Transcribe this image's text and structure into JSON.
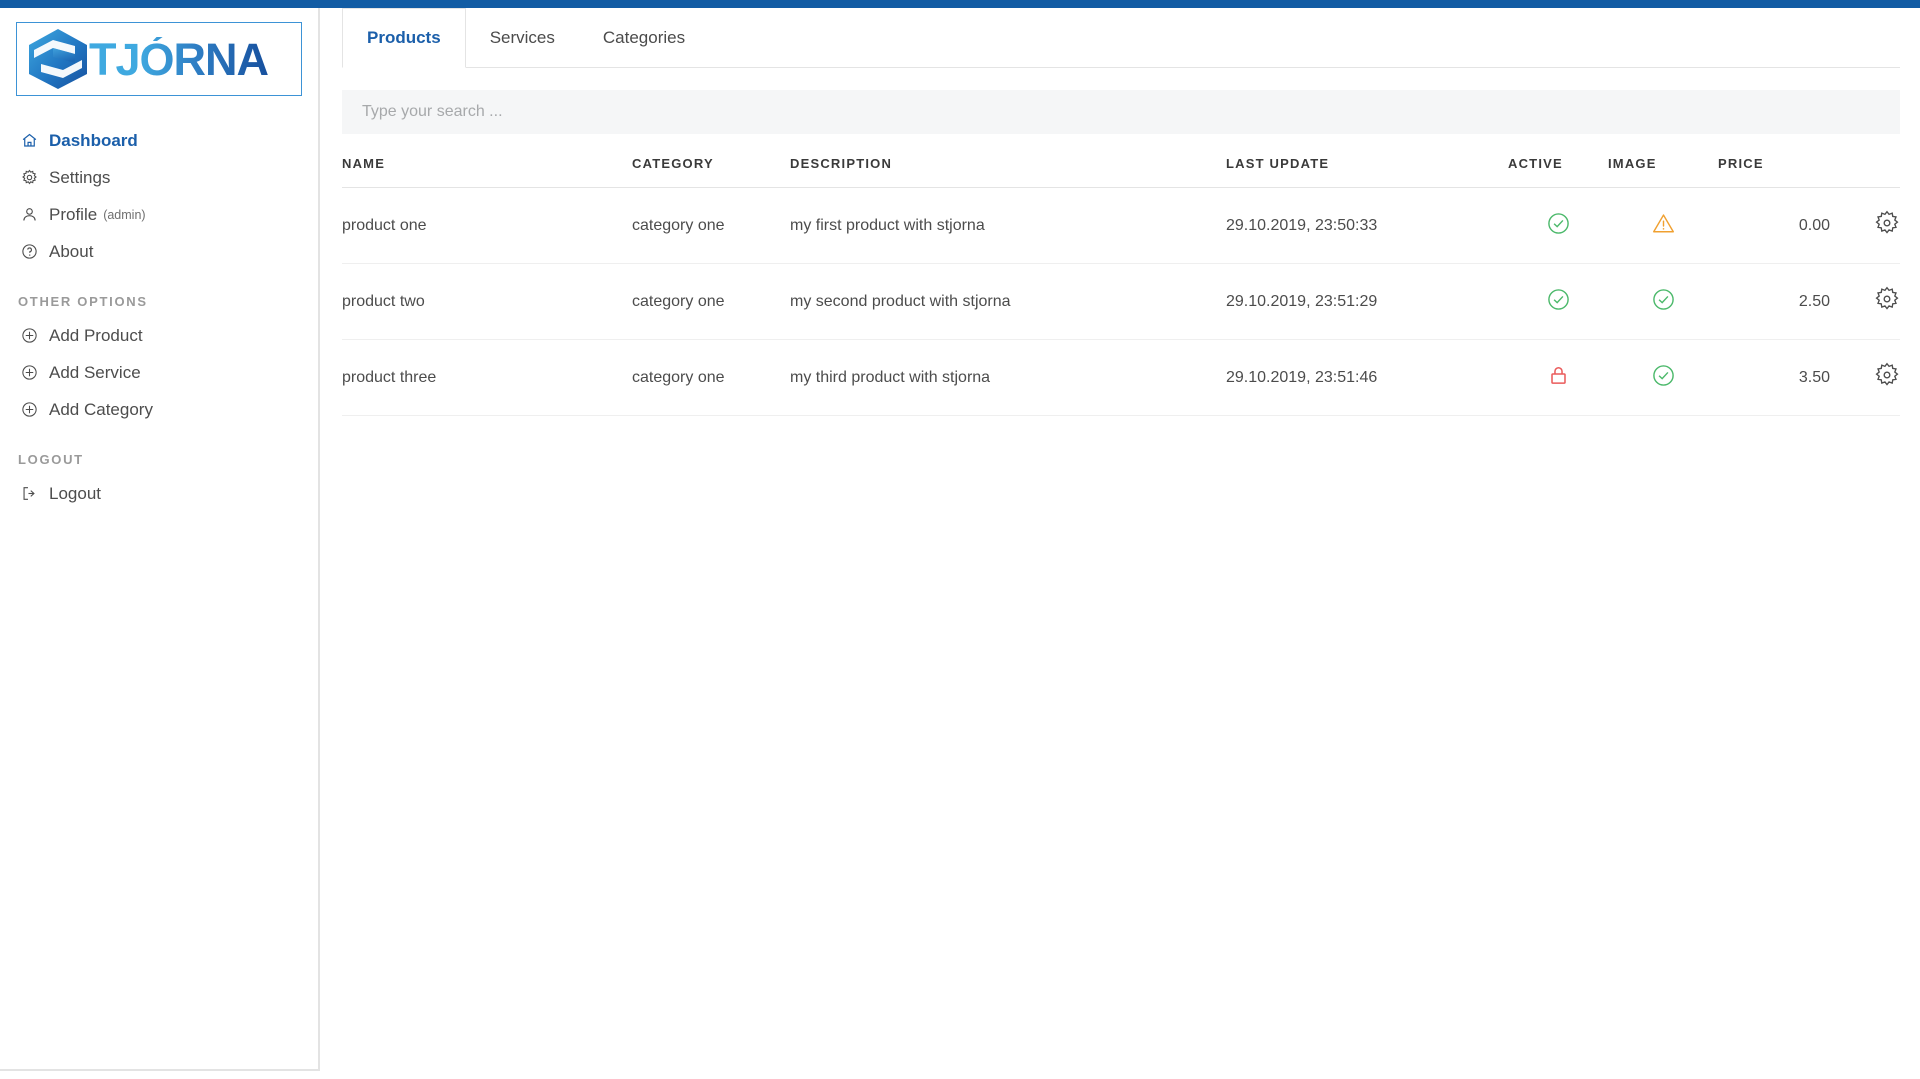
{
  "theme": {
    "accent": "#125ca4",
    "logo_border": "#3d93d6",
    "active_green": "#4cb96b",
    "warn_orange": "#f0a030",
    "locked_red": "#ea5b5b",
    "muted_text": "#9a9a9a"
  },
  "sidebar": {
    "logo": {
      "text": "TJÓRNA",
      "icon": "stjorna-hexagon-logo"
    },
    "items": [
      {
        "label": "Dashboard",
        "icon": "home-icon",
        "active": true
      },
      {
        "label": "Settings",
        "icon": "gear-icon",
        "active": false
      },
      {
        "label": "Profile",
        "sub": "(admin)",
        "icon": "user-icon",
        "active": false
      },
      {
        "label": "About",
        "icon": "question-circle-icon",
        "active": false
      }
    ],
    "other_options": {
      "title": "OTHER OPTIONS",
      "items": [
        {
          "label": "Add Product",
          "icon": "plus-circle-icon"
        },
        {
          "label": "Add Service",
          "icon": "plus-circle-icon"
        },
        {
          "label": "Add Category",
          "icon": "plus-circle-icon"
        }
      ]
    },
    "logout_section": {
      "title": "LOGOUT",
      "items": [
        {
          "label": "Logout",
          "icon": "sign-out-icon"
        }
      ]
    }
  },
  "main": {
    "tabs": [
      {
        "label": "Products",
        "active": true
      },
      {
        "label": "Services",
        "active": false
      },
      {
        "label": "Categories",
        "active": false
      }
    ],
    "search": {
      "value": "",
      "placeholder": "Type your search ..."
    },
    "table": {
      "columns": [
        "NAME",
        "CATEGORY",
        "DESCRIPTION",
        "LAST UPDATE",
        "ACTIVE",
        "IMAGE",
        "PRICE",
        ""
      ],
      "rows": [
        {
          "name": "product one",
          "category": "category one",
          "description": "my first product with stjorna",
          "last_update": "29.10.2019, 23:50:33",
          "active": "check-circle-icon",
          "image": "warning-triangle-icon",
          "price": "0.00",
          "action": "gear-icon"
        },
        {
          "name": "product two",
          "category": "category one",
          "description": "my second product with stjorna",
          "last_update": "29.10.2019, 23:51:29",
          "active": "check-circle-icon",
          "image": "check-circle-icon",
          "price": "2.50",
          "action": "gear-icon"
        },
        {
          "name": "product three",
          "category": "category one",
          "description": "my third product with stjorna",
          "last_update": "29.10.2019, 23:51:46",
          "active": "lock-icon",
          "image": "check-circle-icon",
          "price": "3.50",
          "action": "gear-icon"
        }
      ]
    }
  }
}
